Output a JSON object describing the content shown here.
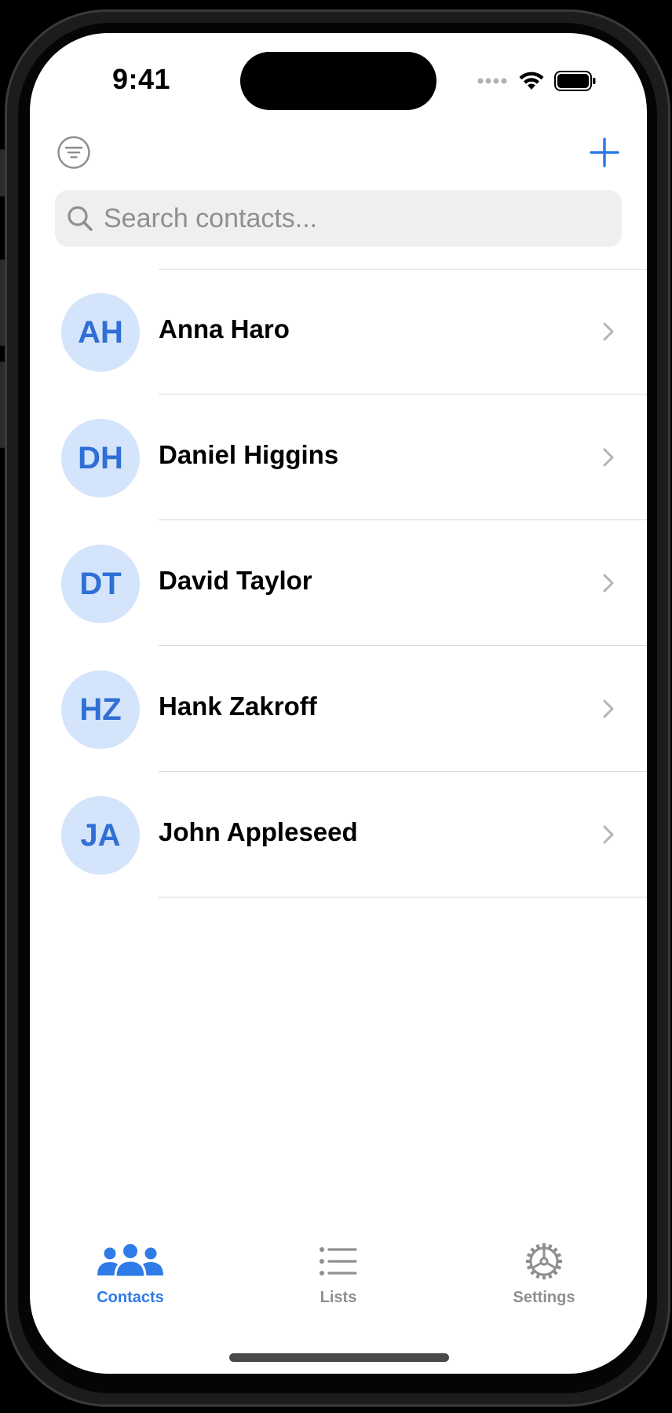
{
  "status_bar": {
    "time": "9:41"
  },
  "search": {
    "placeholder": "Search contacts..."
  },
  "contacts": [
    {
      "initials": "AH",
      "name": "Anna Haro"
    },
    {
      "initials": "DH",
      "name": "Daniel Higgins"
    },
    {
      "initials": "DT",
      "name": "David Taylor"
    },
    {
      "initials": "HZ",
      "name": "Hank Zakroff"
    },
    {
      "initials": "JA",
      "name": "John Appleseed"
    }
  ],
  "tabs": [
    {
      "label": "Contacts",
      "icon": "people-icon",
      "selected": true
    },
    {
      "label": "Lists",
      "icon": "list-icon",
      "selected": false
    },
    {
      "label": "Settings",
      "icon": "gear-icon",
      "selected": false
    }
  ],
  "colors": {
    "accent": "#2f7be8",
    "avatar_bg": "#d4e4fa",
    "avatar_text": "#2f6fd6",
    "inactive": "#8e8e93",
    "separator": "#d9d9dc"
  }
}
